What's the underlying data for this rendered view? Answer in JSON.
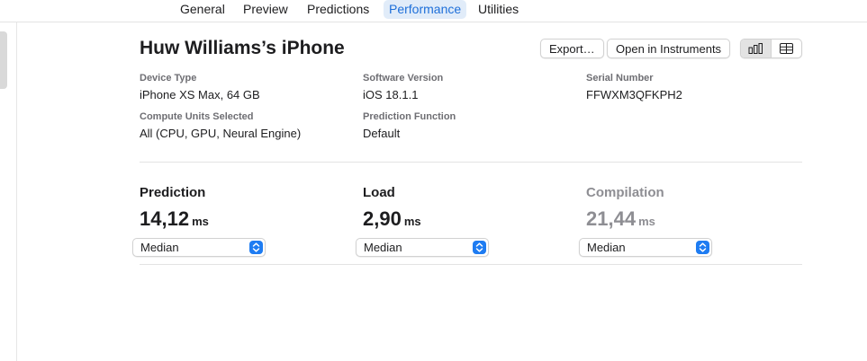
{
  "tabs": {
    "general": "General",
    "preview": "Preview",
    "predictions": "Predictions",
    "performance": "Performance",
    "utilities": "Utilities",
    "active": "Performance"
  },
  "header": {
    "device_name": "Huw Williams’s iPhone",
    "export_label": "Export…",
    "open_instruments_label": "Open in Instruments",
    "view_toggle": {
      "selected": "chart-icon",
      "options": [
        "chart-icon",
        "table-icon"
      ]
    }
  },
  "details": {
    "device_type": {
      "label": "Device Type",
      "value": "iPhone XS Max, 64 GB"
    },
    "software_version": {
      "label": "Software Version",
      "value": "iOS 18.1.1"
    },
    "serial_number": {
      "label": "Serial Number",
      "value": "FFWXM3QFKPH2"
    },
    "compute_units": {
      "label": "Compute Units Selected",
      "value": "All (CPU, GPU, Neural Engine)"
    },
    "prediction_function": {
      "label": "Prediction Function",
      "value": "Default"
    }
  },
  "metrics": {
    "prediction": {
      "title": "Prediction",
      "value": "14,12",
      "unit": "ms",
      "aggregate": "Median"
    },
    "load": {
      "title": "Load",
      "value": "2,90",
      "unit": "ms",
      "aggregate": "Median"
    },
    "compilation": {
      "title": "Compilation",
      "value": "21,44",
      "unit": "ms",
      "aggregate": "Median"
    }
  },
  "colors": {
    "accent": "#1e7cf2",
    "active_tab_bg": "#e1ecf9",
    "active_tab_text": "#1e6fd9",
    "secondary_text": "#6e6e73",
    "dimmed_metric": "#8e8e93"
  }
}
